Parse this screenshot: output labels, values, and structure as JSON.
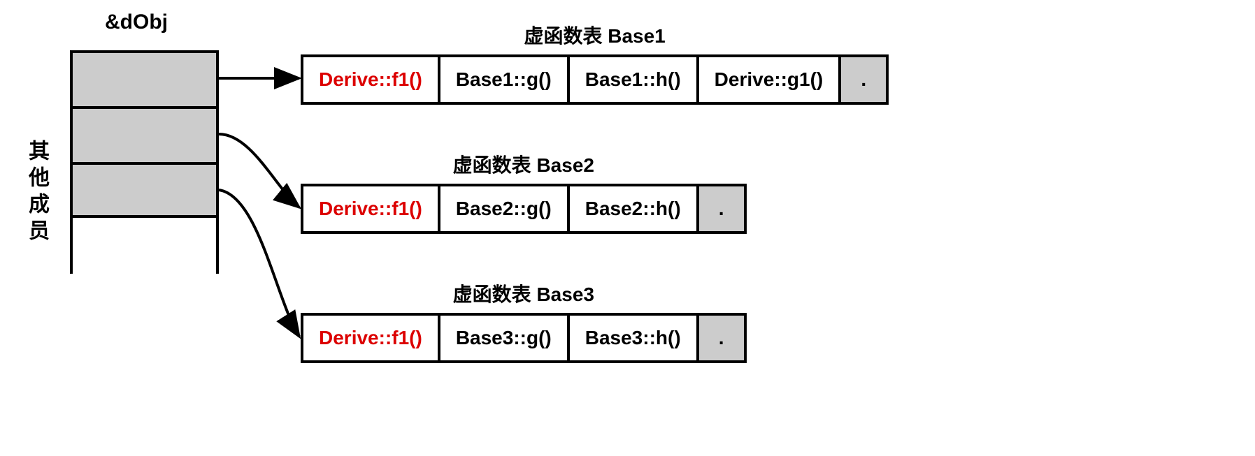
{
  "object": {
    "label": "&dObj",
    "side_label": "其他成员"
  },
  "vtables": [
    {
      "title": "虚函数表 Base1",
      "cells": [
        {
          "text": "Derive::f1()",
          "override": true
        },
        {
          "text": "Base1::g()",
          "override": false
        },
        {
          "text": "Base1::h()",
          "override": false
        },
        {
          "text": "Derive::g1()",
          "override": false
        }
      ],
      "terminator": "."
    },
    {
      "title": "虚函数表 Base2",
      "cells": [
        {
          "text": "Derive::f1()",
          "override": true
        },
        {
          "text": "Base2::g()",
          "override": false
        },
        {
          "text": "Base2::h()",
          "override": false
        }
      ],
      "terminator": "."
    },
    {
      "title": "虚函数表 Base3",
      "cells": [
        {
          "text": "Derive::f1()",
          "override": true
        },
        {
          "text": "Base3::g()",
          "override": false
        },
        {
          "text": "Base3::h()",
          "override": false
        }
      ],
      "terminator": "."
    }
  ]
}
